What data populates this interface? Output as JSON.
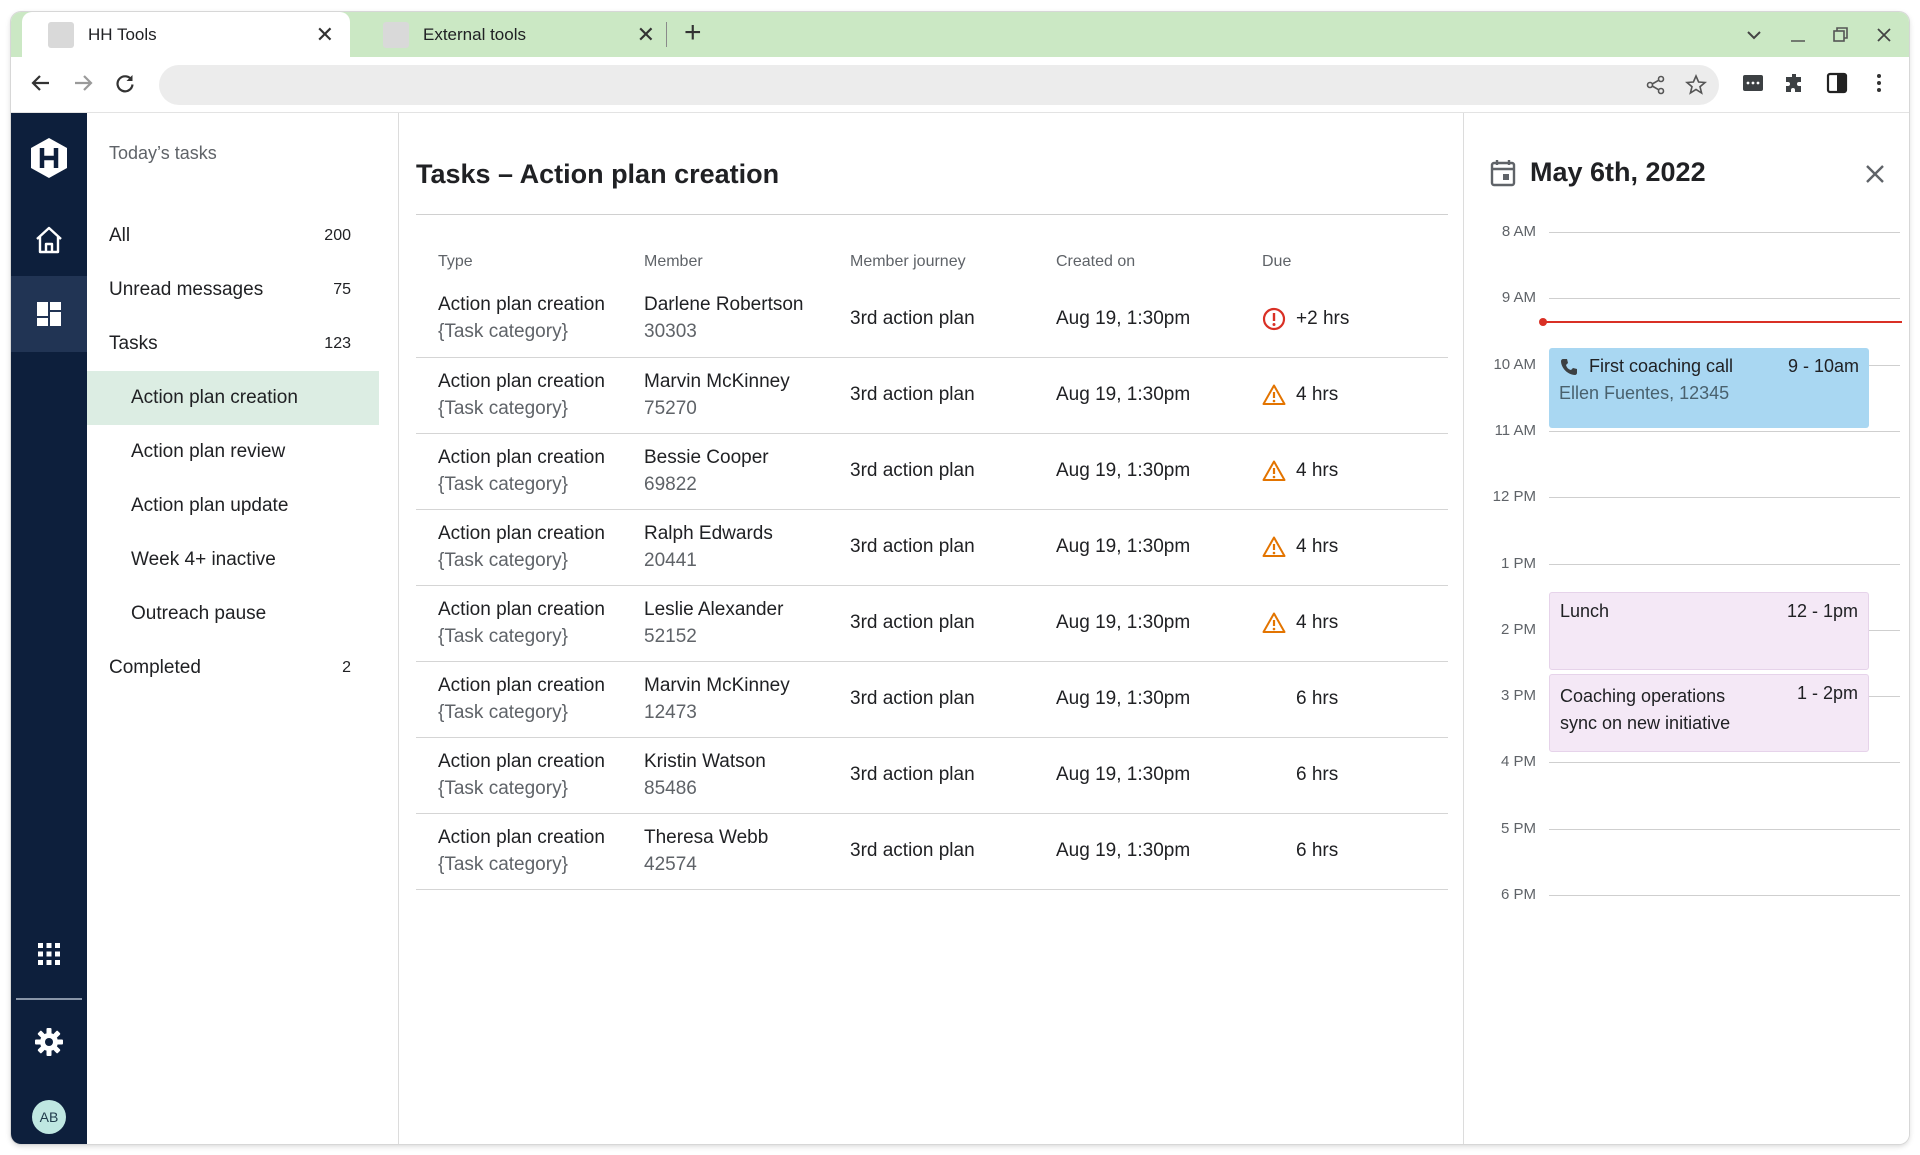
{
  "browser": {
    "tabs": [
      {
        "title": "HH Tools",
        "close": "✕"
      },
      {
        "title": "External tools",
        "close": "✕"
      }
    ],
    "new_tab": "+"
  },
  "rail": {
    "avatar_initials": "AB"
  },
  "sidebar": {
    "title": "Today’s tasks",
    "items": [
      {
        "label": "All",
        "count": "200"
      },
      {
        "label": "Unread messages",
        "count": "75"
      },
      {
        "label": "Tasks",
        "count": "123"
      },
      {
        "label": "Action plan creation"
      },
      {
        "label": "Action plan review"
      },
      {
        "label": "Action plan update"
      },
      {
        "label": "Week 4+ inactive"
      },
      {
        "label": "Outreach pause"
      },
      {
        "label": "Completed",
        "count": "2"
      }
    ]
  },
  "main": {
    "title": "Tasks – Action plan creation",
    "columns": [
      "Type",
      "Member",
      "Member journey",
      "Created on",
      "Due"
    ],
    "rows": [
      {
        "type": "Action plan creation",
        "category": "{Task category}",
        "member": "Darlene Robertson",
        "member_id": "30303",
        "journey": "3rd action plan",
        "created": "Aug 19, 1:30pm",
        "due": "+2 hrs",
        "status": "overdue"
      },
      {
        "type": "Action plan creation",
        "category": "{Task category}",
        "member": "Marvin McKinney",
        "member_id": "75270",
        "journey": "3rd action plan",
        "created": "Aug 19, 1:30pm",
        "due": "4 hrs",
        "status": "warning"
      },
      {
        "type": "Action plan creation",
        "category": "{Task category}",
        "member": "Bessie Cooper",
        "member_id": "69822",
        "journey": "3rd action plan",
        "created": "Aug 19, 1:30pm",
        "due": "4 hrs",
        "status": "warning"
      },
      {
        "type": "Action plan creation",
        "category": "{Task category}",
        "member": "Ralph Edwards",
        "member_id": "20441",
        "journey": "3rd action plan",
        "created": "Aug 19, 1:30pm",
        "due": "4 hrs",
        "status": "warning"
      },
      {
        "type": "Action plan creation",
        "category": "{Task category}",
        "member": "Leslie Alexander",
        "member_id": "52152",
        "journey": "3rd action plan",
        "created": "Aug 19, 1:30pm",
        "due": "4 hrs",
        "status": "warning"
      },
      {
        "type": "Action plan creation",
        "category": "{Task category}",
        "member": "Marvin McKinney",
        "member_id": "12473",
        "journey": "3rd action plan",
        "created": "Aug 19, 1:30pm",
        "due": "6 hrs",
        "status": "normal"
      },
      {
        "type": "Action plan creation",
        "category": "{Task category}",
        "member": "Kristin Watson",
        "member_id": "85486",
        "journey": "3rd action plan",
        "created": "Aug 19, 1:30pm",
        "due": "6 hrs",
        "status": "normal"
      },
      {
        "type": "Action plan creation",
        "category": "{Task category}",
        "member": "Theresa Webb",
        "member_id": "42574",
        "journey": "3rd action plan",
        "created": "Aug 19, 1:30pm",
        "due": "6 hrs",
        "status": "normal"
      }
    ]
  },
  "calendar": {
    "date": "May 6th, 2022",
    "hours": [
      "8 AM",
      "9 AM",
      "10 AM",
      "11 AM",
      "12 PM",
      "1 PM",
      "2 PM",
      "3 PM",
      "4 PM",
      "5 PM",
      "6 PM"
    ],
    "events": [
      {
        "title": "First coaching call",
        "time": "9 - 10am",
        "subtitle": "Ellen Fuentes, 12345",
        "color": "#a9d7f2"
      },
      {
        "title": "Lunch",
        "time": "12 - 1pm",
        "color": "#f4e8f6"
      },
      {
        "title": "Coaching operations sync on new initiative",
        "time": "1 - 2pm",
        "color": "#f4e8f6"
      }
    ]
  },
  "colors": {
    "rail_bg": "#0d1f3c",
    "tabstrip_bg": "#cbe8c4",
    "active_nav_bg": "#dcede3",
    "overdue": "#d93025",
    "warning": "#e37400",
    "now_line": "#d93025"
  },
  "icons": [
    "hh-logo-icon",
    "home-icon",
    "dashboard-icon",
    "apps-grid-icon",
    "settings-icon",
    "calendar-icon",
    "close-icon",
    "phone-icon",
    "error-circle-icon",
    "warning-triangle-icon"
  ]
}
